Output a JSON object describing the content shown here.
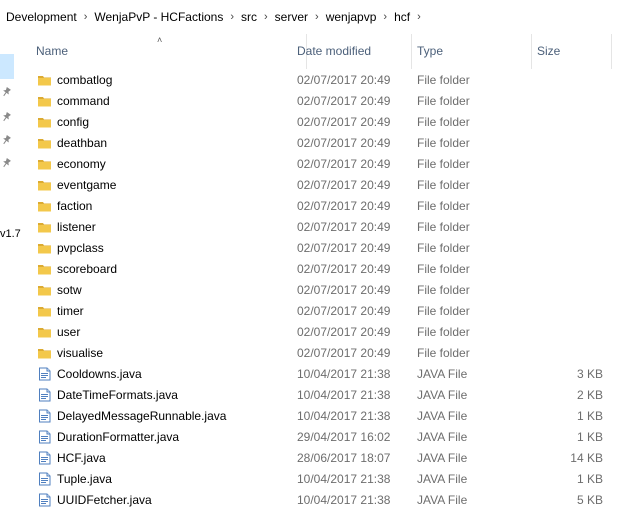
{
  "breadcrumb": [
    "Development",
    "WenjaPvP - HCFactions",
    "src",
    "server",
    "wenjapvp",
    "hcf"
  ],
  "nav": {
    "partial_label": "v1.7"
  },
  "columns": {
    "name": "Name",
    "date": "Date modified",
    "type": "Type",
    "size": "Size"
  },
  "colors": {
    "header_text": "#4c607a",
    "folder": "#f3c84b",
    "selected_bg": "#cce8ff",
    "meta_text": "#6d6d6d"
  },
  "files": [
    {
      "name": "combatlog",
      "date": "02/07/2017 20:49",
      "type": "File folder",
      "size": "",
      "icon": "folder-icon"
    },
    {
      "name": "command",
      "date": "02/07/2017 20:49",
      "type": "File folder",
      "size": "",
      "icon": "folder-icon"
    },
    {
      "name": "config",
      "date": "02/07/2017 20:49",
      "type": "File folder",
      "size": "",
      "icon": "folder-icon"
    },
    {
      "name": "deathban",
      "date": "02/07/2017 20:49",
      "type": "File folder",
      "size": "",
      "icon": "folder-icon"
    },
    {
      "name": "economy",
      "date": "02/07/2017 20:49",
      "type": "File folder",
      "size": "",
      "icon": "folder-icon"
    },
    {
      "name": "eventgame",
      "date": "02/07/2017 20:49",
      "type": "File folder",
      "size": "",
      "icon": "folder-icon"
    },
    {
      "name": "faction",
      "date": "02/07/2017 20:49",
      "type": "File folder",
      "size": "",
      "icon": "folder-icon"
    },
    {
      "name": "listener",
      "date": "02/07/2017 20:49",
      "type": "File folder",
      "size": "",
      "icon": "folder-icon"
    },
    {
      "name": "pvpclass",
      "date": "02/07/2017 20:49",
      "type": "File folder",
      "size": "",
      "icon": "folder-icon"
    },
    {
      "name": "scoreboard",
      "date": "02/07/2017 20:49",
      "type": "File folder",
      "size": "",
      "icon": "folder-icon"
    },
    {
      "name": "sotw",
      "date": "02/07/2017 20:49",
      "type": "File folder",
      "size": "",
      "icon": "folder-icon"
    },
    {
      "name": "timer",
      "date": "02/07/2017 20:49",
      "type": "File folder",
      "size": "",
      "icon": "folder-icon"
    },
    {
      "name": "user",
      "date": "02/07/2017 20:49",
      "type": "File folder",
      "size": "",
      "icon": "folder-icon"
    },
    {
      "name": "visualise",
      "date": "02/07/2017 20:49",
      "type": "File folder",
      "size": "",
      "icon": "folder-icon"
    },
    {
      "name": "Cooldowns.java",
      "date": "10/04/2017 21:38",
      "type": "JAVA File",
      "size": "3 KB",
      "icon": "java-file-icon"
    },
    {
      "name": "DateTimeFormats.java",
      "date": "10/04/2017 21:38",
      "type": "JAVA File",
      "size": "2 KB",
      "icon": "java-file-icon"
    },
    {
      "name": "DelayedMessageRunnable.java",
      "date": "10/04/2017 21:38",
      "type": "JAVA File",
      "size": "1 KB",
      "icon": "java-file-icon"
    },
    {
      "name": "DurationFormatter.java",
      "date": "29/04/2017 16:02",
      "type": "JAVA File",
      "size": "1 KB",
      "icon": "java-file-icon"
    },
    {
      "name": "HCF.java",
      "date": "28/06/2017 18:07",
      "type": "JAVA File",
      "size": "14 KB",
      "icon": "java-file-icon"
    },
    {
      "name": "Tuple.java",
      "date": "10/04/2017 21:38",
      "type": "JAVA File",
      "size": "1 KB",
      "icon": "java-file-icon"
    },
    {
      "name": "UUIDFetcher.java",
      "date": "10/04/2017 21:38",
      "type": "JAVA File",
      "size": "5 KB",
      "icon": "java-file-icon"
    }
  ]
}
